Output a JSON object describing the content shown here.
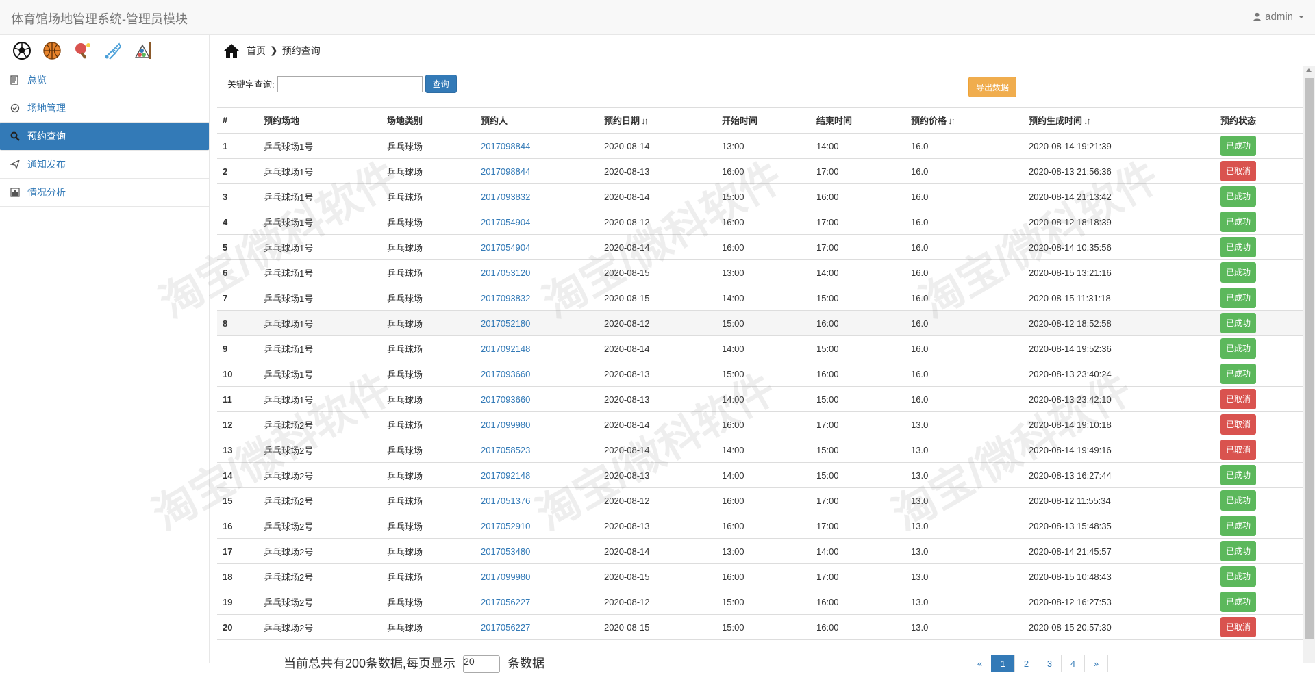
{
  "app": {
    "title": "体育馆场地管理系统-管理员模块",
    "user": "admin"
  },
  "sidebar": {
    "sports": [
      "soccer-icon",
      "basketball-icon",
      "pingpong-icon",
      "badminton-icon",
      "billiards-icon"
    ],
    "items": [
      {
        "label": "总览",
        "icon": "dashboard-icon"
      },
      {
        "label": "场地管理",
        "icon": "venue-icon"
      },
      {
        "label": "预约查询",
        "icon": "search-icon"
      },
      {
        "label": "通知发布",
        "icon": "send-icon"
      },
      {
        "label": "情况分析",
        "icon": "chart-icon"
      }
    ]
  },
  "breadcrumb": {
    "home": "首页",
    "current": "预约查询"
  },
  "toolbar": {
    "keyword_label": "关键字查询:",
    "keyword_value": "",
    "search_label": "查询",
    "export_label": "导出数据"
  },
  "table": {
    "headers": [
      "#",
      "预约场地",
      "场地类别",
      "预约人",
      "预约日期",
      "开始时间",
      "结束时间",
      "预约价格",
      "预约生成时间",
      "预约状态"
    ],
    "rows": [
      {
        "id": "1",
        "venue": "乒乓球场1号",
        "type": "乒乓球场",
        "user": "2017098844",
        "date": "2020-08-14",
        "start": "13:00",
        "end": "14:00",
        "price": "16.0",
        "created": "2020-08-14 19:21:39",
        "status": "已成功"
      },
      {
        "id": "2",
        "venue": "乒乓球场1号",
        "type": "乒乓球场",
        "user": "2017098844",
        "date": "2020-08-13",
        "start": "16:00",
        "end": "17:00",
        "price": "16.0",
        "created": "2020-08-13 21:56:36",
        "status": "已取消"
      },
      {
        "id": "3",
        "venue": "乒乓球场1号",
        "type": "乒乓球场",
        "user": "2017093832",
        "date": "2020-08-14",
        "start": "15:00",
        "end": "16:00",
        "price": "16.0",
        "created": "2020-08-14 21:13:42",
        "status": "已成功"
      },
      {
        "id": "4",
        "venue": "乒乓球场1号",
        "type": "乒乓球场",
        "user": "2017054904",
        "date": "2020-08-12",
        "start": "16:00",
        "end": "17:00",
        "price": "16.0",
        "created": "2020-08-12 18:18:39",
        "status": "已成功"
      },
      {
        "id": "5",
        "venue": "乒乓球场1号",
        "type": "乒乓球场",
        "user": "2017054904",
        "date": "2020-08-14",
        "start": "16:00",
        "end": "17:00",
        "price": "16.0",
        "created": "2020-08-14 10:35:56",
        "status": "已成功"
      },
      {
        "id": "6",
        "venue": "乒乓球场1号",
        "type": "乒乓球场",
        "user": "2017053120",
        "date": "2020-08-15",
        "start": "13:00",
        "end": "14:00",
        "price": "16.0",
        "created": "2020-08-15 13:21:16",
        "status": "已成功"
      },
      {
        "id": "7",
        "venue": "乒乓球场1号",
        "type": "乒乓球场",
        "user": "2017093832",
        "date": "2020-08-15",
        "start": "14:00",
        "end": "15:00",
        "price": "16.0",
        "created": "2020-08-15 11:31:18",
        "status": "已成功"
      },
      {
        "id": "8",
        "venue": "乒乓球场1号",
        "type": "乒乓球场",
        "user": "2017052180",
        "date": "2020-08-12",
        "start": "15:00",
        "end": "16:00",
        "price": "16.0",
        "created": "2020-08-12 18:52:58",
        "status": "已成功"
      },
      {
        "id": "9",
        "venue": "乒乓球场1号",
        "type": "乒乓球场",
        "user": "2017092148",
        "date": "2020-08-14",
        "start": "14:00",
        "end": "15:00",
        "price": "16.0",
        "created": "2020-08-14 19:52:36",
        "status": "已成功"
      },
      {
        "id": "10",
        "venue": "乒乓球场1号",
        "type": "乒乓球场",
        "user": "2017093660",
        "date": "2020-08-13",
        "start": "15:00",
        "end": "16:00",
        "price": "16.0",
        "created": "2020-08-13 23:40:24",
        "status": "已成功"
      },
      {
        "id": "11",
        "venue": "乒乓球场1号",
        "type": "乒乓球场",
        "user": "2017093660",
        "date": "2020-08-13",
        "start": "14:00",
        "end": "15:00",
        "price": "16.0",
        "created": "2020-08-13 23:42:10",
        "status": "已取消"
      },
      {
        "id": "12",
        "venue": "乒乓球场2号",
        "type": "乒乓球场",
        "user": "2017099980",
        "date": "2020-08-14",
        "start": "16:00",
        "end": "17:00",
        "price": "13.0",
        "created": "2020-08-14 19:10:18",
        "status": "已取消"
      },
      {
        "id": "13",
        "venue": "乒乓球场2号",
        "type": "乒乓球场",
        "user": "2017058523",
        "date": "2020-08-14",
        "start": "14:00",
        "end": "15:00",
        "price": "13.0",
        "created": "2020-08-14 19:49:16",
        "status": "已取消"
      },
      {
        "id": "14",
        "venue": "乒乓球场2号",
        "type": "乒乓球场",
        "user": "2017092148",
        "date": "2020-08-13",
        "start": "14:00",
        "end": "15:00",
        "price": "13.0",
        "created": "2020-08-13 16:27:44",
        "status": "已成功"
      },
      {
        "id": "15",
        "venue": "乒乓球场2号",
        "type": "乒乓球场",
        "user": "2017051376",
        "date": "2020-08-12",
        "start": "16:00",
        "end": "17:00",
        "price": "13.0",
        "created": "2020-08-12 11:55:34",
        "status": "已成功"
      },
      {
        "id": "16",
        "venue": "乒乓球场2号",
        "type": "乒乓球场",
        "user": "2017052910",
        "date": "2020-08-13",
        "start": "16:00",
        "end": "17:00",
        "price": "13.0",
        "created": "2020-08-13 15:48:35",
        "status": "已成功"
      },
      {
        "id": "17",
        "venue": "乒乓球场2号",
        "type": "乒乓球场",
        "user": "2017053480",
        "date": "2020-08-14",
        "start": "13:00",
        "end": "14:00",
        "price": "13.0",
        "created": "2020-08-14 21:45:57",
        "status": "已成功"
      },
      {
        "id": "18",
        "venue": "乒乓球场2号",
        "type": "乒乓球场",
        "user": "2017099980",
        "date": "2020-08-15",
        "start": "16:00",
        "end": "17:00",
        "price": "13.0",
        "created": "2020-08-15 10:48:43",
        "status": "已成功"
      },
      {
        "id": "19",
        "venue": "乒乓球场2号",
        "type": "乒乓球场",
        "user": "2017056227",
        "date": "2020-08-12",
        "start": "15:00",
        "end": "16:00",
        "price": "13.0",
        "created": "2020-08-12 16:27:53",
        "status": "已成功"
      },
      {
        "id": "20",
        "venue": "乒乓球场2号",
        "type": "乒乓球场",
        "user": "2017056227",
        "date": "2020-08-15",
        "start": "15:00",
        "end": "16:00",
        "price": "13.0",
        "created": "2020-08-15 20:57:30",
        "status": "已取消"
      }
    ]
  },
  "footer": {
    "summary_prefix": "当前总共有",
    "total": "200",
    "summary_mid": "条数据,每页显示",
    "page_size": "20",
    "summary_suffix": "条数据",
    "pages": [
      "1",
      "2",
      "3",
      "4"
    ]
  },
  "watermark": "淘宝/微科软件",
  "colors": {
    "primary": "#337ab7",
    "success": "#5cb85c",
    "danger": "#d9534f",
    "warning": "#f0ad4e"
  }
}
